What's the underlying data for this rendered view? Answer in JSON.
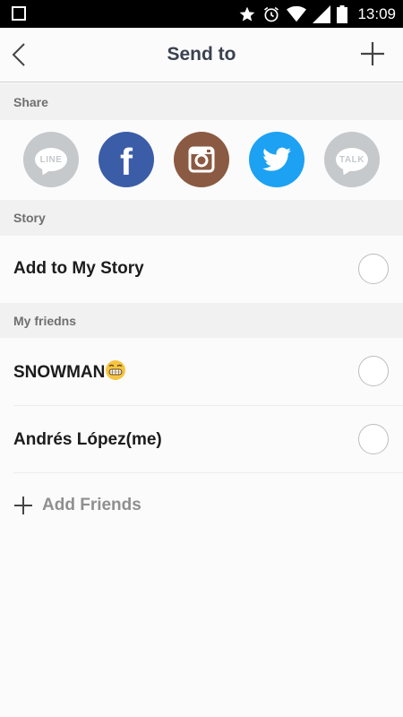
{
  "status_bar": {
    "time": "13:09"
  },
  "header": {
    "title": "Send to",
    "back_icon": "back-chevron-icon",
    "add_icon": "plus-icon"
  },
  "share": {
    "label": "Share",
    "items": [
      {
        "name": "LINE",
        "label": "LINE",
        "color": "#c5c9cc"
      },
      {
        "name": "Facebook",
        "label": "f",
        "color": "#3b5da8"
      },
      {
        "name": "Instagram",
        "label": "",
        "color": "#8b5a43"
      },
      {
        "name": "Twitter",
        "label": "",
        "color": "#1da1f2"
      },
      {
        "name": "KakaoTalk",
        "label": "TALK",
        "color": "#c5c9cc"
      }
    ]
  },
  "story": {
    "label": "Story",
    "items": [
      {
        "label": "Add to My Story",
        "selected": false
      }
    ]
  },
  "friends": {
    "label": "My friedns",
    "items": [
      {
        "label": "SNOWMAN",
        "emoji": "grinning-face",
        "selected": false
      },
      {
        "label": "Andrés López(me)",
        "selected": false
      }
    ],
    "add_label": "Add Friends"
  },
  "colors": {
    "header_text": "#3a4250",
    "section_bg": "#f1f1f1"
  }
}
